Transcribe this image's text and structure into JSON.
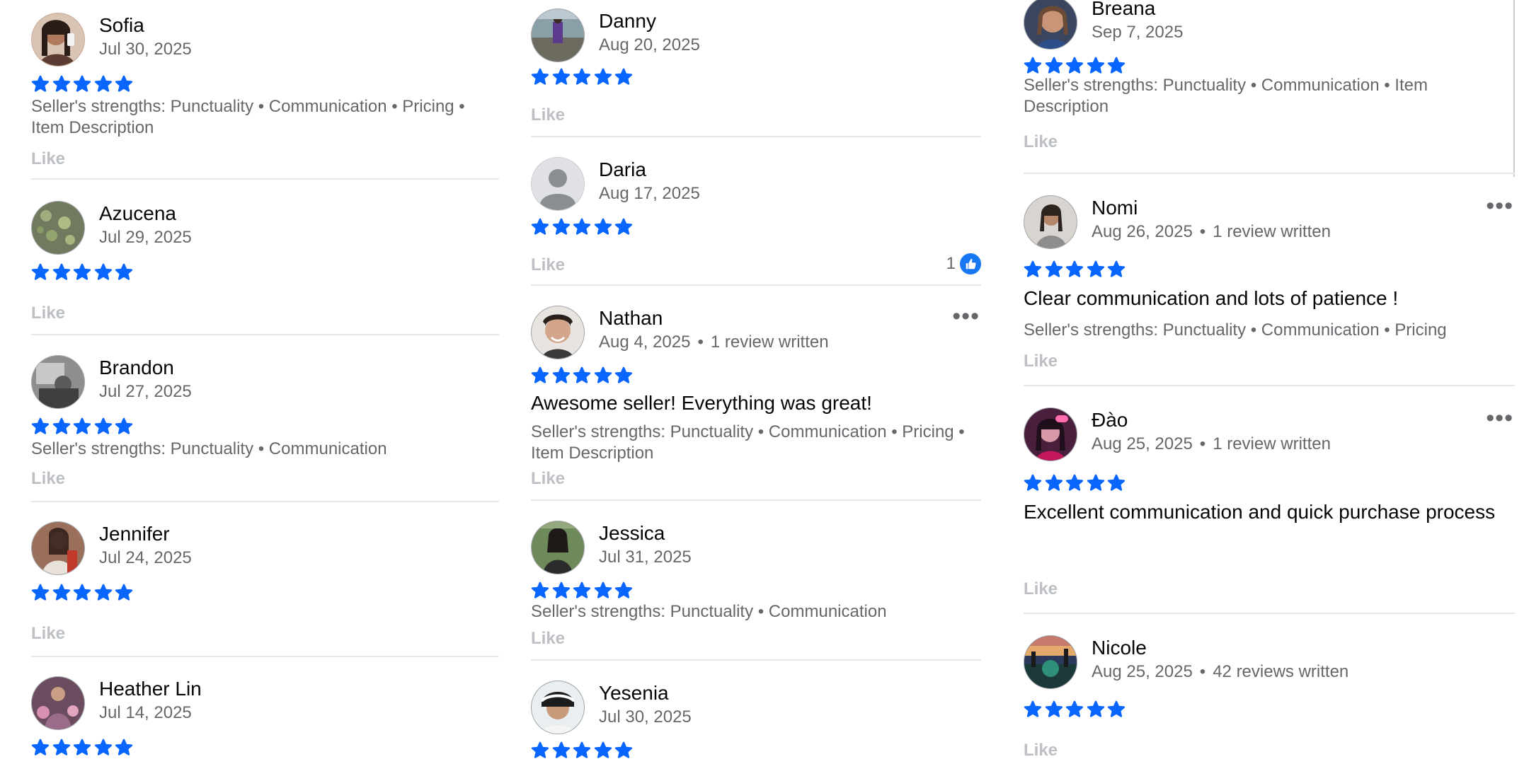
{
  "colors": {
    "star": "#0866ff",
    "secondary_text": "#65676b",
    "like_text": "#bcc0c4",
    "divider": "#e4e6eb"
  },
  "columns": [
    {
      "reviews": [
        {
          "name": "Sofia",
          "date": "Jul 30, 2025",
          "rating": 5,
          "strengths": "Seller's strengths: Punctuality • Communication • Pricing • Item Description",
          "like": "Like"
        },
        {
          "name": "Azucena",
          "date": "Jul 29, 2025",
          "rating": 5,
          "like": "Like"
        },
        {
          "name": "Brandon",
          "date": "Jul 27, 2025",
          "rating": 5,
          "strengths": "Seller's strengths: Punctuality • Communication",
          "like": "Like"
        },
        {
          "name": "Jennifer",
          "date": "Jul 24, 2025",
          "rating": 5,
          "like": "Like"
        },
        {
          "name": "Heather Lin",
          "date": "Jul 14, 2025",
          "rating": 5
        }
      ]
    },
    {
      "reviews": [
        {
          "name": "Danny",
          "date": "Aug 20, 2025",
          "rating": 5,
          "like": "Like"
        },
        {
          "name": "Daria",
          "date": "Aug 17, 2025",
          "rating": 5,
          "like": "Like",
          "like_count": "1"
        },
        {
          "name": "Nathan",
          "date": "Aug 4, 2025",
          "reviews_written": "1 review written",
          "rating": 5,
          "text": "Awesome seller! Everything was great!",
          "strengths": "Seller's strengths: Punctuality • Communication • Pricing • Item Description",
          "like": "Like",
          "more": "•••"
        },
        {
          "name": "Jessica",
          "date": "Jul 31, 2025",
          "rating": 5,
          "strengths": "Seller's strengths: Punctuality • Communication",
          "like": "Like"
        },
        {
          "name": "Yesenia",
          "date": "Jul 30, 2025",
          "rating": 5
        }
      ]
    },
    {
      "reviews": [
        {
          "name": "Breana",
          "date": "Sep 7, 2025",
          "rating": 5,
          "strengths": "Seller's strengths: Punctuality • Communication • Item Description",
          "like": "Like"
        },
        {
          "name": "Nomi",
          "date": "Aug 26, 2025",
          "reviews_written": "1 review written",
          "rating": 5,
          "text": "Clear communication and lots of patience !",
          "strengths": "Seller's strengths: Punctuality • Communication • Pricing",
          "like": "Like",
          "more": "•••"
        },
        {
          "name": "Đào",
          "date": "Aug 25, 2025",
          "reviews_written": "1 review written",
          "rating": 5,
          "text": "Excellent communication and quick purchase process",
          "like": "Like",
          "more": "•••"
        },
        {
          "name": "Nicole",
          "date": "Aug 25, 2025",
          "reviews_written": "42 reviews written",
          "rating": 5,
          "like": "Like"
        }
      ]
    }
  ]
}
